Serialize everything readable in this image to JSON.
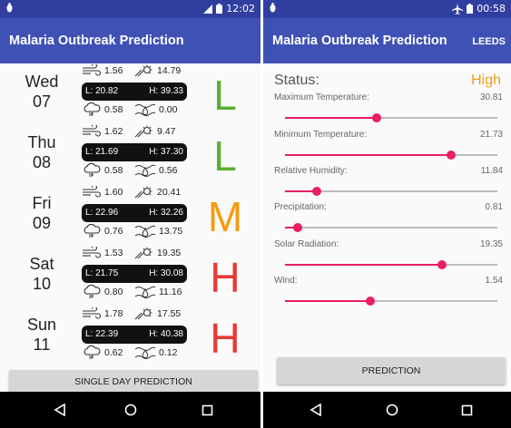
{
  "left": {
    "status_time": "12:02",
    "app_title": "Malaria Outbreak Prediction",
    "days": [
      {
        "day": "Wed",
        "date": "07",
        "wind": "1.56",
        "solar": "14.79",
        "low": "L: 20.82",
        "high": "H: 39.33",
        "precip": "0.58",
        "humidity": "0.00",
        "risk": "L",
        "risk_color": "#5bb030"
      },
      {
        "day": "Thu",
        "date": "08",
        "wind": "1.62",
        "solar": "9.47",
        "low": "L: 21.69",
        "high": "H: 37.30",
        "precip": "0.58",
        "humidity": "0.56",
        "risk": "L",
        "risk_color": "#5bb030"
      },
      {
        "day": "Fri",
        "date": "09",
        "wind": "1.60",
        "solar": "20.41",
        "low": "L: 22.96",
        "high": "H: 32.26",
        "precip": "0.76",
        "humidity": "13.75",
        "risk": "M",
        "risk_color": "#f39c12"
      },
      {
        "day": "Sat",
        "date": "10",
        "wind": "1.53",
        "solar": "19.35",
        "low": "L: 21.75",
        "high": "H: 30.08",
        "precip": "0.80",
        "humidity": "11.16",
        "risk": "H",
        "risk_color": "#e53935"
      },
      {
        "day": "Sun",
        "date": "11",
        "wind": "1.78",
        "solar": "17.55",
        "low": "L: 22.39",
        "high": "H: 40.38",
        "precip": "0.62",
        "humidity": "0.12",
        "risk": "H",
        "risk_color": "#e53935"
      }
    ],
    "button_label": "SINGLE DAY PREDICTION"
  },
  "right": {
    "status_time": "00:58",
    "app_title": "Malaria Outbreak Prediction",
    "action_label": "LEEDS",
    "status_label": "Status:",
    "status_value": "High",
    "status_color": "#f39c12",
    "params": [
      {
        "name": "Maximum Temperature:",
        "value": "30.81",
        "slider_level": 0.43
      },
      {
        "name": "Minimum Temperature:",
        "value": "21.73",
        "slider_level": 0.78
      },
      {
        "name": "Relative Humidity:",
        "value": "11.84",
        "slider_level": 0.15
      },
      {
        "name": "Precipitation:",
        "value": "0.81",
        "slider_level": 0.06
      },
      {
        "name": "Solar Radiation:",
        "value": "19.35",
        "slider_level": 0.74
      },
      {
        "name": "Wind:",
        "value": "1.54",
        "slider_level": 0.4
      }
    ],
    "button_label": "PREDICTION"
  },
  "colors": {
    "primary": "#3f51b5",
    "primary_dark": "#303f9f",
    "accent": "#e91e63"
  },
  "icons": [
    "wind-icon",
    "solar-icon",
    "cloud-rain-icon",
    "humidity-icon",
    "back-icon",
    "home-icon",
    "recents-icon",
    "airplane-icon",
    "battery-icon",
    "signal-icon"
  ]
}
